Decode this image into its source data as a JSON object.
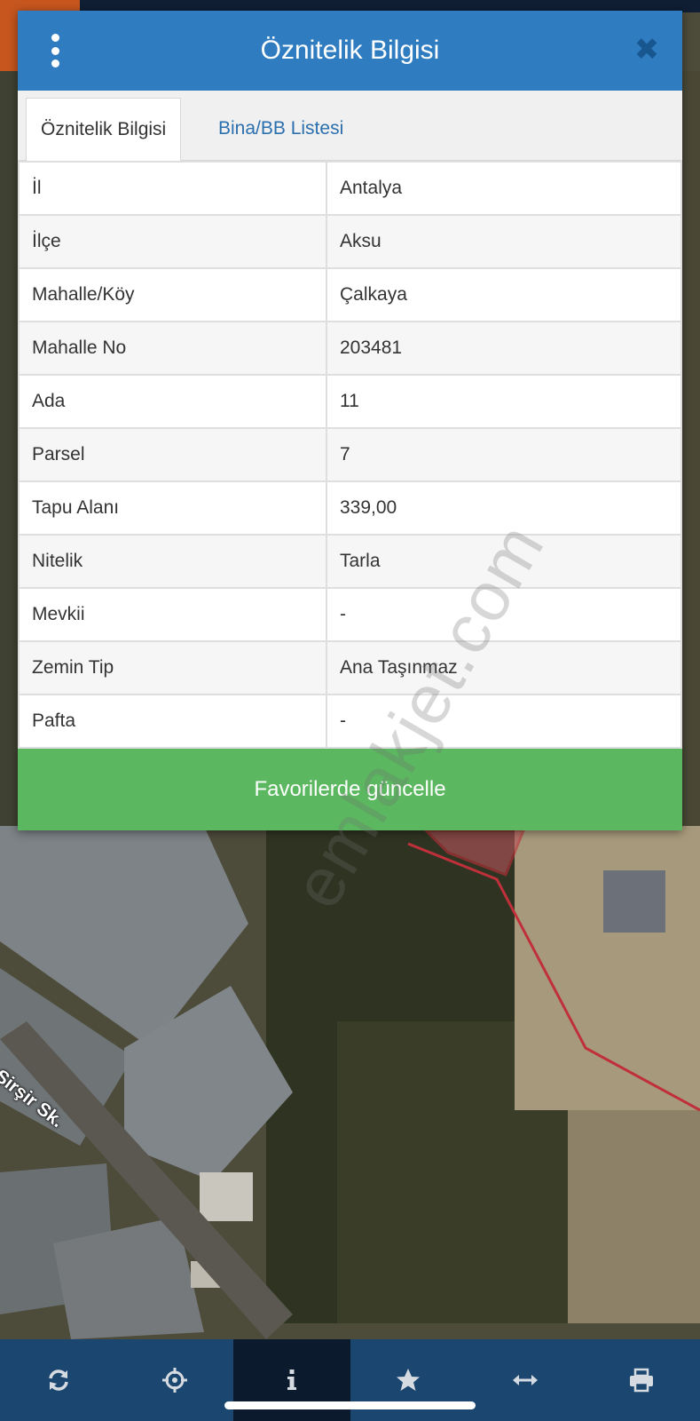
{
  "dialog": {
    "title": "Öznitelik Bilgisi",
    "tabs": [
      {
        "label": "Öznitelik Bilgisi",
        "active": true
      },
      {
        "label": "Bina/BB Listesi",
        "active": false
      }
    ],
    "rows": [
      {
        "key": "İl",
        "value": "Antalya"
      },
      {
        "key": "İlçe",
        "value": "Aksu"
      },
      {
        "key": "Mahalle/Köy",
        "value": "Çalkaya"
      },
      {
        "key": "Mahalle No",
        "value": "203481"
      },
      {
        "key": "Ada",
        "value": "11"
      },
      {
        "key": "Parsel",
        "value": "7"
      },
      {
        "key": "Tapu Alanı",
        "value": "339,00"
      },
      {
        "key": "Nitelik",
        "value": "Tarla"
      },
      {
        "key": "Mevkii",
        "value": "-"
      },
      {
        "key": "Zemin Tip",
        "value": "Ana Taşınmaz"
      },
      {
        "key": "Pafta",
        "value": "-"
      }
    ],
    "favorite_button": "Favorilerde güncelle"
  },
  "map": {
    "street_label": "Şirşir Sk."
  },
  "watermark": "emlakjet.com",
  "toolbar": {
    "items": [
      {
        "icon": "refresh-icon"
      },
      {
        "icon": "crosshair-icon"
      },
      {
        "icon": "info-icon",
        "active": true
      },
      {
        "icon": "star-icon"
      },
      {
        "icon": "measure-icon"
      },
      {
        "icon": "print-icon"
      }
    ]
  },
  "colors": {
    "header": "#2f7cc1",
    "button": "#5cb860",
    "toolbar": "#1b4670",
    "parcel_outline": "#c0303a"
  }
}
